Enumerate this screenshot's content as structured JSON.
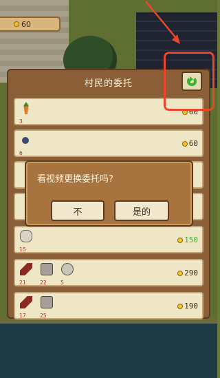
{
  "currency": {
    "amount": "60"
  },
  "panel": {
    "title": "村民的委托",
    "refresh_icon": "refresh-icon"
  },
  "orders": [
    {
      "items": [
        {
          "icon": "carrot-icon",
          "count": "3"
        }
      ],
      "reward": "60",
      "reward_color": "#3a2a14"
    },
    {
      "items": [
        {
          "icon": "orb-icon",
          "count": "6"
        }
      ],
      "reward": "60",
      "reward_color": "#3a2a14"
    },
    {
      "items": [],
      "reward": "",
      "reward_color": "#3a2a14"
    },
    {
      "items": [],
      "reward": "",
      "reward_color": "#3a2a14"
    },
    {
      "items": [
        {
          "icon": "stone-icon",
          "count": "15"
        }
      ],
      "reward": "150",
      "reward_color": "#3fae2e"
    },
    {
      "items": [
        {
          "icon": "wood-icon",
          "count": "21"
        },
        {
          "icon": "brick-icon",
          "count": "22"
        },
        {
          "icon": "gear-icon",
          "count": "5"
        }
      ],
      "reward": "290",
      "reward_color": "#3a2a14"
    },
    {
      "items": [
        {
          "icon": "wood-icon",
          "count": "17"
        },
        {
          "icon": "brick-icon",
          "count": "25"
        }
      ],
      "reward": "190",
      "reward_color": "#3a2a14"
    }
  ],
  "dialog": {
    "message": "看视频更换委托吗?",
    "no_label": "不",
    "yes_label": "是的"
  },
  "colors": {
    "accent_annotation": "#e8472a",
    "panel": "#8a5f37",
    "refresh_green": "#3fae2e"
  }
}
